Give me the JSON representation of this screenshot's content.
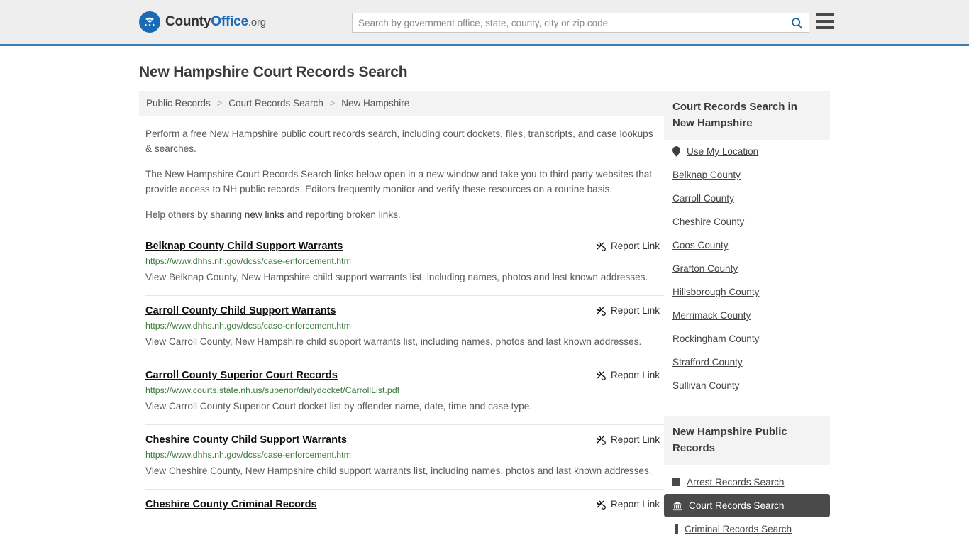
{
  "header": {
    "logo": {
      "part1": "County",
      "part2": "Office",
      "part3": ".org"
    },
    "search": {
      "placeholder": "Search by government office, state, county, city or zip code",
      "value": "",
      "icon": "search-icon"
    },
    "menu_icon": "hamburger-menu-icon",
    "accent_color": "#3a7cb5",
    "background_color": "#eeeeee"
  },
  "page": {
    "title": "New Hampshire Court Records Search"
  },
  "breadcrumb": {
    "items": [
      {
        "label": "Public Records"
      },
      {
        "label": "Court Records Search"
      },
      {
        "label": "New Hampshire"
      }
    ],
    "separator": ">"
  },
  "intro": {
    "p1": "Perform a free New Hampshire public court records search, including court dockets, files, transcripts, and case lookups & searches.",
    "p2": "The New Hampshire Court Records Search links below open in a new window and take you to third party websites that provide access to NH public records. Editors frequently monitor and verify these resources on a routine basis.",
    "p3_before": "Help others by sharing ",
    "p3_link": "new links",
    "p3_after": " and reporting broken links."
  },
  "results": {
    "report_label": "Report Link",
    "report_icon": "broken-link-icon",
    "items": [
      {
        "title": "Belknap County Child Support Warrants",
        "url": "https://www.dhhs.nh.gov/dcss/case-enforcement.htm",
        "description": "View Belknap County, New Hampshire child support warrants list, including names, photos and last known addresses."
      },
      {
        "title": "Carroll County Child Support Warrants",
        "url": "https://www.dhhs.nh.gov/dcss/case-enforcement.htm",
        "description": "View Carroll County, New Hampshire child support warrants list, including names, photos and last known addresses."
      },
      {
        "title": "Carroll County Superior Court Records",
        "url": "https://www.courts.state.nh.us/superior/dailydocket/CarrollList.pdf",
        "description": "View Carroll County Superior Court docket list by offender name, date, time and case type."
      },
      {
        "title": "Cheshire County Child Support Warrants",
        "url": "https://www.dhhs.nh.gov/dcss/case-enforcement.htm",
        "description": "View Cheshire County, New Hampshire child support warrants list, including names, photos and last known addresses."
      },
      {
        "title": "Cheshire County Criminal Records",
        "url": "",
        "description": ""
      }
    ]
  },
  "sidebar": {
    "counties_box": {
      "heading": "Court Records Search in New Hampshire",
      "use_my_location": {
        "label": "Use My Location",
        "icon": "map-pin-icon"
      },
      "counties": [
        {
          "label": "Belknap County"
        },
        {
          "label": "Carroll County"
        },
        {
          "label": "Cheshire County"
        },
        {
          "label": "Coos County"
        },
        {
          "label": "Grafton County"
        },
        {
          "label": "Hillsborough County"
        },
        {
          "label": "Merrimack County"
        },
        {
          "label": "Rockingham County"
        },
        {
          "label": "Strafford County"
        },
        {
          "label": "Sullivan County"
        }
      ]
    },
    "public_records_box": {
      "heading": "New Hampshire Public Records",
      "items": [
        {
          "label": "Arrest Records Search",
          "icon": "square-icon",
          "active": false
        },
        {
          "label": "Court Records Search",
          "icon": "courthouse-icon",
          "active": true
        },
        {
          "label": "Criminal Records Search",
          "icon": "bar-icon",
          "active": false
        }
      ]
    }
  }
}
